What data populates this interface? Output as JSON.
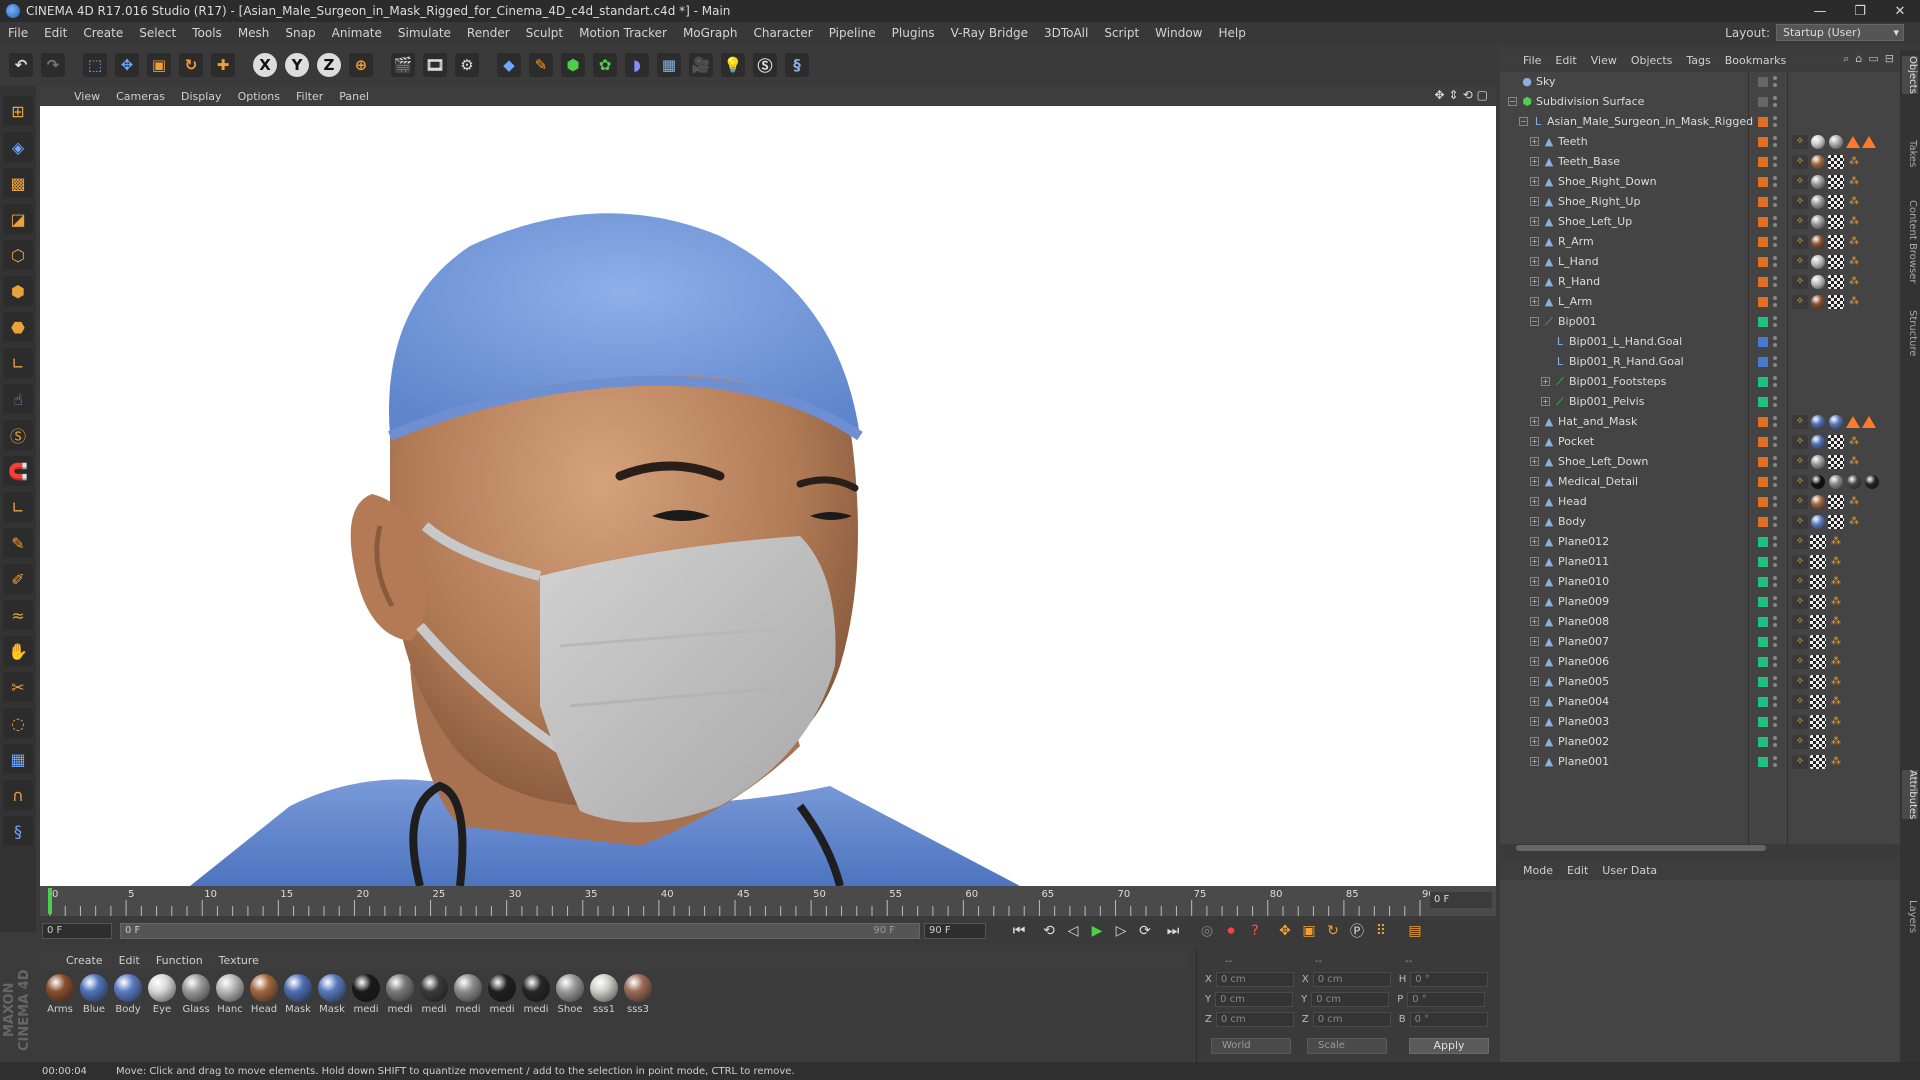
{
  "titlebar": {
    "title": "CINEMA 4D R17.016 Studio (R17) - [Asian_Male_Surgeon_in_Mask_Rigged_for_Cinema_4D_c4d_standart.c4d *] - Main",
    "min": "—",
    "max": "❐",
    "close": "✕"
  },
  "menubar": {
    "items": [
      "File",
      "Edit",
      "Create",
      "Select",
      "Tools",
      "Mesh",
      "Snap",
      "Animate",
      "Simulate",
      "Render",
      "Sculpt",
      "Motion Tracker",
      "MoGraph",
      "Character",
      "Pipeline",
      "Plugins",
      "V-Ray Bridge",
      "3DToAll",
      "Script",
      "Window",
      "Help"
    ],
    "layout_label": "Layout:",
    "layout_value": "Startup (User)"
  },
  "toolbar": {
    "icons": [
      "undo-icon",
      "redo-icon",
      "live-select-icon",
      "move-icon",
      "scale-icon",
      "rotate-icon",
      "last-tool-icon",
      "x-axis-icon",
      "y-axis-icon",
      "z-axis-icon",
      "world-coords-icon",
      "render-view-icon",
      "render-picture-viewer-icon",
      "edit-render-settings-icon",
      "cube-icon",
      "pen-icon",
      "subdivision-icon",
      "cloner-icon",
      "deformer-icon",
      "floor-icon",
      "camera-icon",
      "light-icon",
      "vray-icon",
      "python-icon"
    ],
    "axis_x": "X",
    "axis_y": "Y",
    "axis_z": "Z"
  },
  "viewport": {
    "menu": [
      "View",
      "Cameras",
      "Display",
      "Options",
      "Filter",
      "Panel"
    ]
  },
  "timeline": {
    "ticks": [
      "0",
      "5",
      "10",
      "15",
      "20",
      "25",
      "30",
      "35",
      "40",
      "45",
      "50",
      "55",
      "60",
      "65",
      "70",
      "75",
      "80",
      "85",
      "90"
    ],
    "current_frame": "0 F"
  },
  "transport": {
    "start_field": "0 F",
    "scrub_left": "0 F",
    "scrub_right": "90 F",
    "end_field": "90 F"
  },
  "materials": {
    "menu": [
      "Create",
      "Edit",
      "Function",
      "Texture"
    ],
    "items": [
      {
        "name": "Arms",
        "color": "#8a4e2e"
      },
      {
        "name": "Blue",
        "color": "#4f72b8"
      },
      {
        "name": "Body",
        "color": "#5a7cc2"
      },
      {
        "name": "Eye",
        "color": "#d8d8d8"
      },
      {
        "name": "Glass",
        "color": "#9a9a9a"
      },
      {
        "name": "Hanc",
        "color": "#b8b8b8"
      },
      {
        "name": "Head",
        "color": "#a0673f"
      },
      {
        "name": "Mask",
        "color": "#4e6fb4"
      },
      {
        "name": "Mask",
        "color": "#5878bc"
      },
      {
        "name": "medi",
        "color": "#1a1a1a"
      },
      {
        "name": "medi",
        "color": "#7a7a7a"
      },
      {
        "name": "medi",
        "color": "#3a3a3a"
      },
      {
        "name": "medi",
        "color": "#8c8c8c"
      },
      {
        "name": "medi",
        "color": "#202020"
      },
      {
        "name": "medi",
        "color": "#262626"
      },
      {
        "name": "Shoe",
        "color": "#9a9a9a"
      },
      {
        "name": "sss1",
        "color": "#cfcfc8"
      },
      {
        "name": "sss3",
        "color": "#9a6a56"
      }
    ]
  },
  "coords": {
    "header_a": "--",
    "header_b": "--",
    "header_c": "--",
    "rows": [
      {
        "a": "X",
        "av": "0 cm",
        "b": "X",
        "bv": "0 cm",
        "c": "H",
        "cv": "0 °"
      },
      {
        "a": "Y",
        "av": "0 cm",
        "b": "Y",
        "bv": "0 cm",
        "c": "P",
        "cv": "0 °"
      },
      {
        "a": "Z",
        "av": "0 cm",
        "b": "Z",
        "bv": "0 cm",
        "c": "B",
        "cv": "0 °"
      }
    ],
    "world": "World",
    "scale": "Scale",
    "apply": "Apply"
  },
  "status": {
    "time": "00:00:04",
    "message": "Move: Click and drag to move elements. Hold down SHIFT to quantize movement / add to the selection in point mode, CTRL to remove."
  },
  "objects": {
    "menu": [
      "File",
      "Edit",
      "View",
      "Objects",
      "Tags",
      "Bookmarks"
    ],
    "rows": [
      {
        "name": "Sky",
        "indent": 0,
        "icon": "sky",
        "layer": "",
        "exp": false
      },
      {
        "name": "Subdivision Surface",
        "indent": 0,
        "icon": "subd",
        "layer": "",
        "exp": true
      },
      {
        "name": "Asian_Male_Surgeon_in_Mask_Rigged",
        "indent": 1,
        "icon": "null",
        "layer": "#e07020",
        "exp": true
      },
      {
        "name": "Teeth",
        "indent": 2,
        "icon": "poly",
        "layer": "#e07020",
        "exp": true,
        "tags": [
          "phong",
          "ball:#ccc",
          "ball:#aaa",
          "tri",
          "tri"
        ]
      },
      {
        "name": "Teeth_Base",
        "indent": 2,
        "icon": "poly",
        "layer": "#e07020",
        "exp": true,
        "tags": [
          "phong",
          "ball:#a0673f",
          "chk",
          "wt"
        ]
      },
      {
        "name": "Shoe_Right_Down",
        "indent": 2,
        "icon": "poly",
        "layer": "#e07020",
        "exp": true,
        "tags": [
          "phong",
          "ball:#999",
          "chk",
          "wt"
        ]
      },
      {
        "name": "Shoe_Right_Up",
        "indent": 2,
        "icon": "poly",
        "layer": "#e07020",
        "exp": true,
        "tags": [
          "phong",
          "ball:#999",
          "chk",
          "wt"
        ]
      },
      {
        "name": "Shoe_Left_Up",
        "indent": 2,
        "icon": "poly",
        "layer": "#e07020",
        "exp": true,
        "tags": [
          "phong",
          "ball:#999",
          "chk",
          "wt"
        ]
      },
      {
        "name": "R_Arm",
        "indent": 2,
        "icon": "poly",
        "layer": "#e07020",
        "exp": true,
        "tags": [
          "phong",
          "ball:#8a4e2e",
          "chk",
          "wt"
        ]
      },
      {
        "name": "L_Hand",
        "indent": 2,
        "icon": "poly",
        "layer": "#e07020",
        "exp": true,
        "tags": [
          "phong",
          "ball:#bbb",
          "chk",
          "wt"
        ]
      },
      {
        "name": "R_Hand",
        "indent": 2,
        "icon": "poly",
        "layer": "#e07020",
        "exp": true,
        "tags": [
          "phong",
          "ball:#bbb",
          "chk",
          "wt"
        ]
      },
      {
        "name": "L_Arm",
        "indent": 2,
        "icon": "poly",
        "layer": "#e07020",
        "exp": true,
        "tags": [
          "phong",
          "ball:#8a4e2e",
          "chk",
          "wt"
        ]
      },
      {
        "name": "Bip001",
        "indent": 2,
        "icon": "bone",
        "layer": "#20c080",
        "exp": true
      },
      {
        "name": "Bip001_L_Hand.Goal",
        "indent": 3,
        "icon": "null",
        "layer": "#4a7ad0",
        "exp": false
      },
      {
        "name": "Bip001_R_Hand.Goal",
        "indent": 3,
        "icon": "null",
        "layer": "#4a7ad0",
        "exp": false
      },
      {
        "name": "Bip001_Footsteps",
        "indent": 3,
        "icon": "bone",
        "layer": "#20c080",
        "exp": true
      },
      {
        "name": "Bip001_Pelvis",
        "indent": 3,
        "icon": "bone",
        "layer": "#20c080",
        "exp": true
      },
      {
        "name": "Hat_and_Mask",
        "indent": 2,
        "icon": "poly",
        "layer": "#e07020",
        "exp": true,
        "tags": [
          "phong",
          "ball:#4e6fb4",
          "ball:#5878bc",
          "tri",
          "tri"
        ]
      },
      {
        "name": "Pocket",
        "indent": 2,
        "icon": "poly",
        "layer": "#e07020",
        "exp": true,
        "tags": [
          "phong",
          "ball:#4e6fb4",
          "chk",
          "wt"
        ]
      },
      {
        "name": "Shoe_Left_Down",
        "indent": 2,
        "icon": "poly",
        "layer": "#e07020",
        "exp": true,
        "tags": [
          "phong",
          "ball:#999",
          "chk",
          "wt"
        ]
      },
      {
        "name": "Medical_Detail",
        "indent": 2,
        "icon": "poly",
        "layer": "#e07020",
        "exp": true,
        "tags": [
          "phong",
          "ball:#111",
          "ball:#888",
          "ball:#444",
          "ball:#222"
        ]
      },
      {
        "name": "Head",
        "indent": 2,
        "icon": "poly",
        "layer": "#e07020",
        "exp": true,
        "tags": [
          "phong",
          "ball:#a0673f",
          "chk",
          "wt"
        ]
      },
      {
        "name": "Body",
        "indent": 2,
        "icon": "poly",
        "layer": "#e07020",
        "exp": true,
        "tags": [
          "phong",
          "ball:#5a7cc2",
          "chk",
          "wt"
        ]
      },
      {
        "name": "Plane012",
        "indent": 2,
        "icon": "poly",
        "layer": "#20c080",
        "exp": true,
        "tags": [
          "phong",
          "chk",
          "wt"
        ]
      },
      {
        "name": "Plane011",
        "indent": 2,
        "icon": "poly",
        "layer": "#20c080",
        "exp": true,
        "tags": [
          "phong",
          "chk",
          "wt"
        ]
      },
      {
        "name": "Plane010",
        "indent": 2,
        "icon": "poly",
        "layer": "#20c080",
        "exp": true,
        "tags": [
          "phong",
          "chk",
          "wt"
        ]
      },
      {
        "name": "Plane009",
        "indent": 2,
        "icon": "poly",
        "layer": "#20c080",
        "exp": true,
        "tags": [
          "phong",
          "chk",
          "wt"
        ]
      },
      {
        "name": "Plane008",
        "indent": 2,
        "icon": "poly",
        "layer": "#20c080",
        "exp": true,
        "tags": [
          "phong",
          "chk",
          "wt"
        ]
      },
      {
        "name": "Plane007",
        "indent": 2,
        "icon": "poly",
        "layer": "#20c080",
        "exp": true,
        "tags": [
          "phong",
          "chk",
          "wt"
        ]
      },
      {
        "name": "Plane006",
        "indent": 2,
        "icon": "poly",
        "layer": "#20c080",
        "exp": true,
        "tags": [
          "phong",
          "chk",
          "wt"
        ]
      },
      {
        "name": "Plane005",
        "indent": 2,
        "icon": "poly",
        "layer": "#20c080",
        "exp": true,
        "tags": [
          "phong",
          "chk",
          "wt"
        ]
      },
      {
        "name": "Plane004",
        "indent": 2,
        "icon": "poly",
        "layer": "#20c080",
        "exp": true,
        "tags": [
          "phong",
          "chk",
          "wt"
        ]
      },
      {
        "name": "Plane003",
        "indent": 2,
        "icon": "poly",
        "layer": "#20c080",
        "exp": true,
        "tags": [
          "phong",
          "chk",
          "wt"
        ]
      },
      {
        "name": "Plane002",
        "indent": 2,
        "icon": "poly",
        "layer": "#20c080",
        "exp": true,
        "tags": [
          "phong",
          "chk",
          "wt"
        ]
      },
      {
        "name": "Plane001",
        "indent": 2,
        "icon": "poly",
        "layer": "#20c080",
        "exp": true,
        "tags": [
          "phong",
          "chk",
          "wt"
        ]
      }
    ]
  },
  "attributes": {
    "menu": [
      "Mode",
      "Edit",
      "User Data"
    ]
  },
  "sidetabs": [
    "Objects",
    "Takes",
    "Content Browser",
    "Structure",
    "Attributes",
    "Layers"
  ],
  "brand": "MAXON CINEMA 4D"
}
